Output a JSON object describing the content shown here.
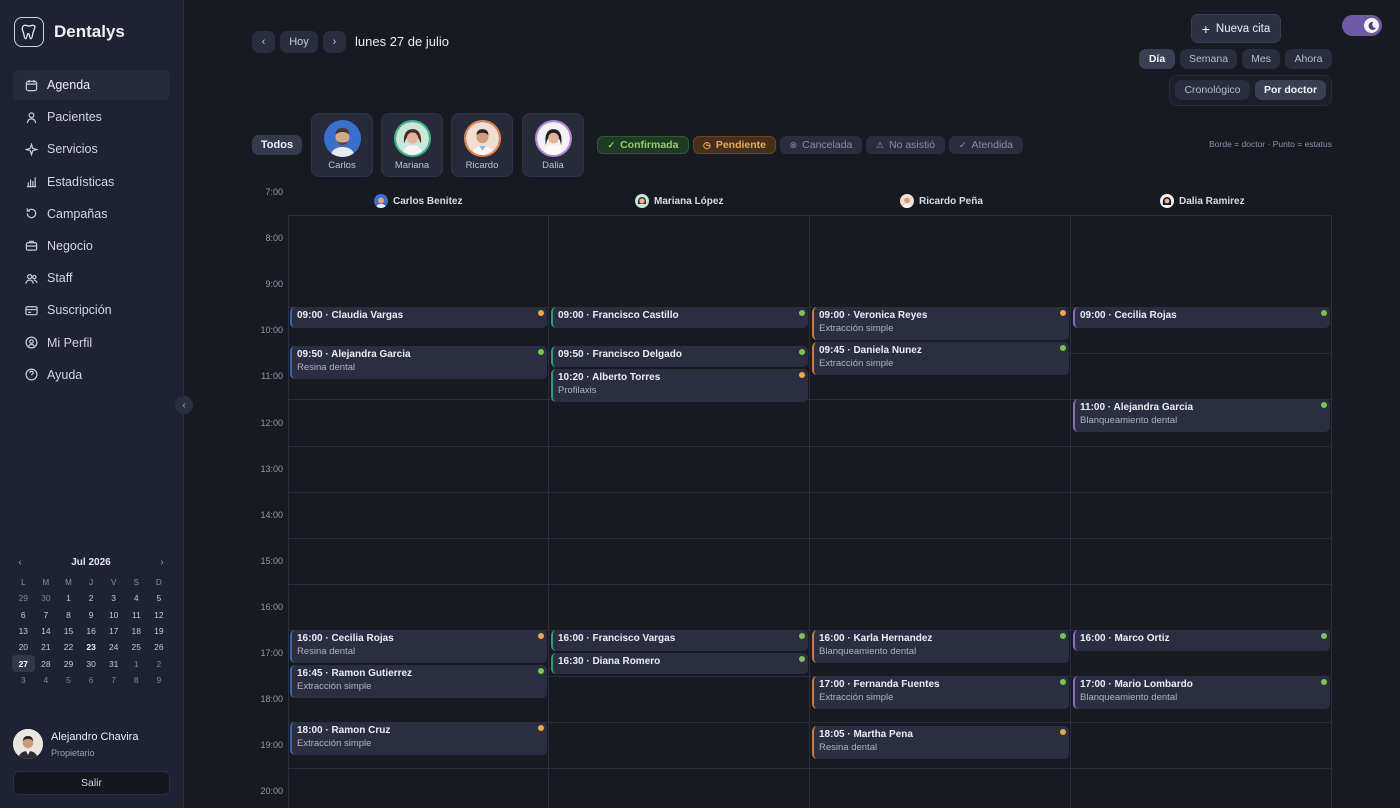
{
  "app": {
    "name": "Dentalys"
  },
  "colors": {
    "confirmed": "#7cc44b",
    "pending": "#f0a640",
    "accent": "#6d5ba6"
  },
  "sidebar": {
    "items": [
      {
        "label": "Agenda",
        "icon": "calendar-icon",
        "active": true
      },
      {
        "label": "Pacientes",
        "icon": "user-icon"
      },
      {
        "label": "Servicios",
        "icon": "sparkle-icon"
      },
      {
        "label": "Estadísticas",
        "icon": "bar-chart-icon"
      },
      {
        "label": "Campañas",
        "icon": "refresh-icon"
      },
      {
        "label": "Negocio",
        "icon": "briefcase-icon"
      },
      {
        "label": "Staff",
        "icon": "users-icon"
      },
      {
        "label": "Suscripción",
        "icon": "card-icon"
      },
      {
        "label": "Mi Perfil",
        "icon": "user-circle-icon"
      },
      {
        "label": "Ayuda",
        "icon": "help-icon"
      }
    ]
  },
  "mini_calendar": {
    "title": "Jul 2026",
    "prev": "‹",
    "next": "›",
    "weekdays": [
      "L",
      "M",
      "M",
      "J",
      "V",
      "S",
      "D"
    ],
    "days": [
      {
        "d": "29",
        "muted": true
      },
      {
        "d": "30",
        "muted": true
      },
      {
        "d": "1"
      },
      {
        "d": "2"
      },
      {
        "d": "3"
      },
      {
        "d": "4"
      },
      {
        "d": "5"
      },
      {
        "d": "6"
      },
      {
        "d": "7"
      },
      {
        "d": "8"
      },
      {
        "d": "9"
      },
      {
        "d": "10"
      },
      {
        "d": "11"
      },
      {
        "d": "12"
      },
      {
        "d": "13"
      },
      {
        "d": "14"
      },
      {
        "d": "15"
      },
      {
        "d": "16"
      },
      {
        "d": "17"
      },
      {
        "d": "18"
      },
      {
        "d": "19"
      },
      {
        "d": "20"
      },
      {
        "d": "21"
      },
      {
        "d": "22"
      },
      {
        "d": "23",
        "bold": true
      },
      {
        "d": "24"
      },
      {
        "d": "25"
      },
      {
        "d": "26"
      },
      {
        "d": "27",
        "today": true
      },
      {
        "d": "28"
      },
      {
        "d": "29"
      },
      {
        "d": "30"
      },
      {
        "d": "31"
      },
      {
        "d": "1",
        "muted": true
      },
      {
        "d": "2",
        "muted": true
      },
      {
        "d": "3",
        "muted": true
      },
      {
        "d": "4",
        "muted": true
      },
      {
        "d": "5",
        "muted": true
      },
      {
        "d": "6",
        "muted": true
      },
      {
        "d": "7",
        "muted": true
      },
      {
        "d": "8",
        "muted": true
      },
      {
        "d": "9",
        "muted": true
      }
    ]
  },
  "user": {
    "name": "Alejandro Chavira",
    "role": "Propietario",
    "logout": "Salir"
  },
  "toolbar": {
    "prev": "‹",
    "today": "Hoy",
    "next": "›",
    "date": "lunes 27 de julio",
    "new_appointment": "Nueva cita",
    "views": [
      "Día",
      "Semana",
      "Mes",
      "Ahora"
    ],
    "sort": [
      "Cronológico",
      "Por doctor"
    ]
  },
  "filters": {
    "all": "Todos",
    "doctors": [
      "Carlos",
      "Mariana",
      "Ricardo",
      "Dalia"
    ],
    "statuses": [
      {
        "label": "Confirmada",
        "icon": "check-icon",
        "color": "#7cc44b"
      },
      {
        "label": "Pendiente",
        "icon": "clock-icon",
        "color": "#f0a640"
      },
      {
        "label": "Cancelada",
        "icon": "x-circle-icon",
        "color": "#8a8fa3"
      },
      {
        "label": "No asistió",
        "icon": "alert-icon",
        "color": "#8a8fa3"
      },
      {
        "label": "Atendida",
        "icon": "check-icon",
        "color": "#8a8fa3"
      }
    ],
    "legend_note": "Borde = doctor · Punto = estatus"
  },
  "schedule": {
    "columns": [
      "Carlos Benitez",
      "Mariana López",
      "Ricardo Peña",
      "Dalia Ramirez"
    ],
    "hours": [
      "7:00",
      "8:00",
      "9:00",
      "10:00",
      "11:00",
      "12:00",
      "13:00",
      "14:00",
      "15:00",
      "16:00",
      "17:00",
      "18:00",
      "19:00",
      "20:00"
    ]
  },
  "appointments": [
    {
      "col": 0,
      "time": "09:00",
      "title": "09:00 · Claudia Vargas",
      "detail": "",
      "status": "pending"
    },
    {
      "col": 0,
      "time": "09:50",
      "title": "09:50 · Alejandra Garcia",
      "detail": "Resina dental",
      "status": "confirmed"
    },
    {
      "col": 0,
      "time": "16:00",
      "title": "16:00 · Cecilia Rojas",
      "detail": "Resina dental",
      "status": "pending"
    },
    {
      "col": 0,
      "time": "16:45",
      "title": "16:45 · Ramon Gutierrez",
      "detail": "Extracción simple",
      "status": "confirmed"
    },
    {
      "col": 0,
      "time": "18:00",
      "title": "18:00 · Ramon Cruz",
      "detail": "Extracción simple",
      "status": "pending"
    },
    {
      "col": 1,
      "time": "09:00",
      "title": "09:00 · Francisco Castillo",
      "detail": "",
      "status": "confirmed"
    },
    {
      "col": 1,
      "time": "09:50",
      "title": "09:50 · Francisco Delgado",
      "detail": "",
      "status": "confirmed"
    },
    {
      "col": 1,
      "time": "10:20",
      "title": "10:20 · Alberto Torres",
      "detail": "Profilaxis",
      "status": "pending"
    },
    {
      "col": 1,
      "time": "16:00",
      "title": "16:00 · Francisco Vargas",
      "detail": "",
      "status": "confirmed"
    },
    {
      "col": 1,
      "time": "16:30",
      "title": "16:30 · Diana Romero",
      "detail": "",
      "status": "confirmed"
    },
    {
      "col": 2,
      "time": "09:00",
      "title": "09:00 · Veronica Reyes",
      "detail": "Extracción simple",
      "status": "pending"
    },
    {
      "col": 2,
      "time": "09:45",
      "title": "09:45 · Daniela Nunez",
      "detail": "Extracción simple",
      "status": "confirmed"
    },
    {
      "col": 2,
      "time": "16:00",
      "title": "16:00 · Karla Hernandez",
      "detail": "Blanqueamiento dental",
      "status": "confirmed"
    },
    {
      "col": 2,
      "time": "17:00",
      "title": "17:00 · Fernanda Fuentes",
      "detail": "Extracción simple",
      "status": "confirmed"
    },
    {
      "col": 2,
      "time": "18:05",
      "title": "18:05 · Martha Pena",
      "detail": "Resina dental",
      "status": "pending"
    },
    {
      "col": 3,
      "time": "09:00",
      "title": "09:00 · Cecilia Rojas",
      "detail": "",
      "status": "confirmed"
    },
    {
      "col": 3,
      "time": "11:00",
      "title": "11:00 · Alejandra Garcia",
      "detail": "Blanqueamiento dental",
      "status": "confirmed"
    },
    {
      "col": 3,
      "time": "16:00",
      "title": "16:00 · Marco Ortiz",
      "detail": "",
      "status": "confirmed"
    },
    {
      "col": 3,
      "time": "17:00",
      "title": "17:00 · Mario Lombardo",
      "detail": "Blanqueamiento dental",
      "status": "confirmed"
    }
  ]
}
